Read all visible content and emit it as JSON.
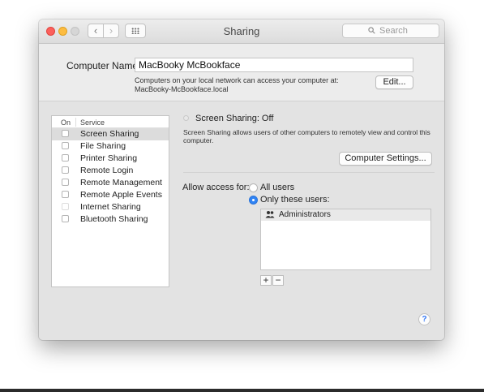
{
  "window": {
    "title": "Sharing",
    "search_placeholder": "Search",
    "nav_back_glyph": "‹",
    "nav_forward_glyph": "›"
  },
  "computer_name": {
    "label": "Computer Name:",
    "value": "MacBooky McBookface",
    "note_line1": "Computers on your local network can access your computer at:",
    "note_line2": "MacBooky-McBookface.local",
    "edit_button": "Edit..."
  },
  "services": {
    "header_on": "On",
    "header_service": "Service",
    "items": [
      {
        "label": "Screen Sharing",
        "enabled": false,
        "selected": true
      },
      {
        "label": "File Sharing",
        "enabled": false
      },
      {
        "label": "Printer Sharing",
        "enabled": false
      },
      {
        "label": "Remote Login",
        "enabled": false
      },
      {
        "label": "Remote Management",
        "enabled": false
      },
      {
        "label": "Remote Apple Events",
        "enabled": false
      },
      {
        "label": "Internet Sharing",
        "enabled": false
      },
      {
        "label": "Bluetooth Sharing",
        "enabled": false
      }
    ]
  },
  "detail": {
    "status": "Screen Sharing: Off",
    "description": "Screen Sharing allows users of other computers to remotely view and control this computer.",
    "computer_settings_button": "Computer Settings...",
    "allow_access_label": "Allow access for:",
    "option_all_users": "All users",
    "option_only_these": "Only these users:",
    "selected_option": "only_these",
    "users": [
      {
        "label": "Administrators",
        "icon": "group-icon"
      }
    ],
    "add_glyph": "+",
    "remove_glyph": "−"
  },
  "help_glyph": "?",
  "colors": {
    "accent": "#2f83f4",
    "close": "#fc605c",
    "minimize": "#fdbc40",
    "zoom": "#d6d6d6"
  }
}
